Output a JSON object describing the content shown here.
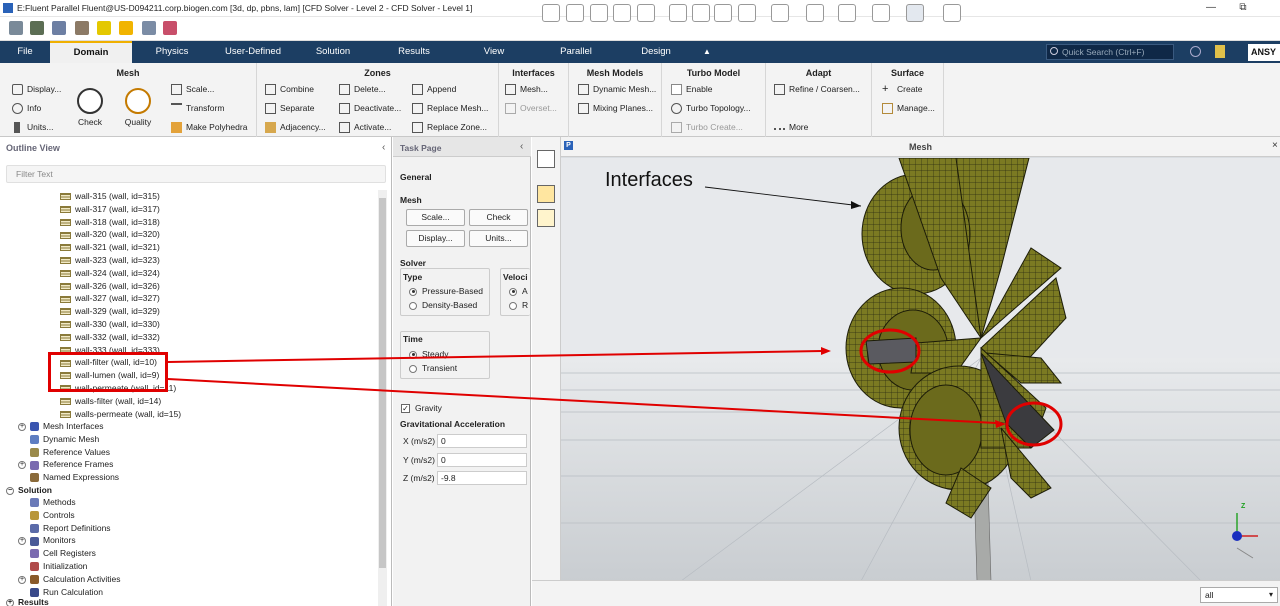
{
  "window": {
    "title": "E:Fluent Parallel Fluent@US-D094211.corp.biogen.com  [3d, dp, pbns, lam] [CFD Solver - Level 2 - CFD Solver - Level 1]",
    "minimize": "—",
    "restore": "⧉"
  },
  "menu": {
    "tabs": [
      "File",
      "Domain",
      "Physics",
      "User-Defined",
      "Solution",
      "Results",
      "View",
      "Parallel",
      "Design"
    ],
    "active": "Domain",
    "collapse_icon": "▲",
    "search_placeholder": "Quick Search (Ctrl+F)",
    "brand": "ANSY"
  },
  "ribbon": {
    "mesh": {
      "title": "Mesh",
      "display": "Display...",
      "info": "Info",
      "units": "Units...",
      "check": "Check",
      "quality": "Quality",
      "scale": "Scale...",
      "transform": "Transform",
      "make_polyhedra": "Make Polyhedra"
    },
    "zones": {
      "title": "Zones",
      "combine": "Combine",
      "separate": "Separate",
      "adjacency": "Adjacency...",
      "delete": "Delete...",
      "deactivate": "Deactivate...",
      "activate": "Activate...",
      "append": "Append",
      "replace_mesh": "Replace Mesh...",
      "replace_zone": "Replace Zone..."
    },
    "interfaces": {
      "title": "Interfaces",
      "mesh": "Mesh...",
      "overset": "Overset..."
    },
    "mesh_models": {
      "title": "Mesh Models",
      "dynamic_mesh": "Dynamic Mesh...",
      "mixing_planes": "Mixing Planes..."
    },
    "turbo_model": {
      "title": "Turbo Model",
      "enable": "Enable",
      "turbo_topology": "Turbo Topology...",
      "turbo_create": "Turbo Create..."
    },
    "adapt": {
      "title": "Adapt",
      "refine": "Refine / Coarsen...",
      "more": "More"
    },
    "surface": {
      "title": "Surface",
      "create": "Create",
      "manage": "Manage..."
    }
  },
  "outline": {
    "title": "Outline View",
    "filter_placeholder": "Filter Text",
    "walls": [
      "wall-315 (wall, id=315)",
      "wall-317 (wall, id=317)",
      "wall-318 (wall, id=318)",
      "wall-320 (wall, id=320)",
      "wall-321 (wall, id=321)",
      "wall-323 (wall, id=323)",
      "wall-324 (wall, id=324)",
      "wall-326 (wall, id=326)",
      "wall-327 (wall, id=327)",
      "wall-329 (wall, id=329)",
      "wall-330 (wall, id=330)",
      "wall-332 (wall, id=332)",
      "wall-333 (wall, id=333)",
      "wall-filter (wall, id=10)",
      "wall-lumen (wall, id=9)",
      "wall-permeate (wall, id=11)",
      "walls-filter (wall, id=14)",
      "walls-permeate (wall, id=15)"
    ],
    "setup_items": [
      "Mesh Interfaces",
      "Dynamic Mesh",
      "Reference Values",
      "Reference Frames",
      "Named Expressions"
    ],
    "solution_header": "Solution",
    "solution_items": [
      "Methods",
      "Controls",
      "Report Definitions",
      "Monitors",
      "Cell Registers",
      "Initialization",
      "Calculation Activities",
      "Run Calculation"
    ],
    "results_header": "Results"
  },
  "task_page": {
    "title": "Task Page",
    "general": "General",
    "mesh_label": "Mesh",
    "scale": "Scale...",
    "check": "Check",
    "display": "Display...",
    "units": "Units...",
    "solver_label": "Solver",
    "type_label": "Type",
    "pressure_based": "Pressure-Based",
    "density_based": "Density-Based",
    "velocity_label": "Veloci",
    "vel_a": "A",
    "vel_r": "R",
    "time_label": "Time",
    "steady": "Steady",
    "transient": "Transient",
    "gravity": "Gravity",
    "grav_accel": "Gravitational Acceleration",
    "x_label": "X (m/s2)",
    "x_val": "0",
    "y_label": "Y (m/s2)",
    "y_val": "0",
    "z_label": "Z (m/s2)",
    "z_val": "-9.8"
  },
  "viewport": {
    "title": "Mesh",
    "annotation": "Interfaces",
    "badge": "P",
    "axis_z": "Z"
  },
  "bottom": {
    "selector": "all"
  },
  "colors": {
    "menu_bg": "#1c3e63",
    "mesh_fill": "#7b7a22",
    "annotation_red": "#e00000",
    "active_tab_accent": "#f0b000"
  }
}
